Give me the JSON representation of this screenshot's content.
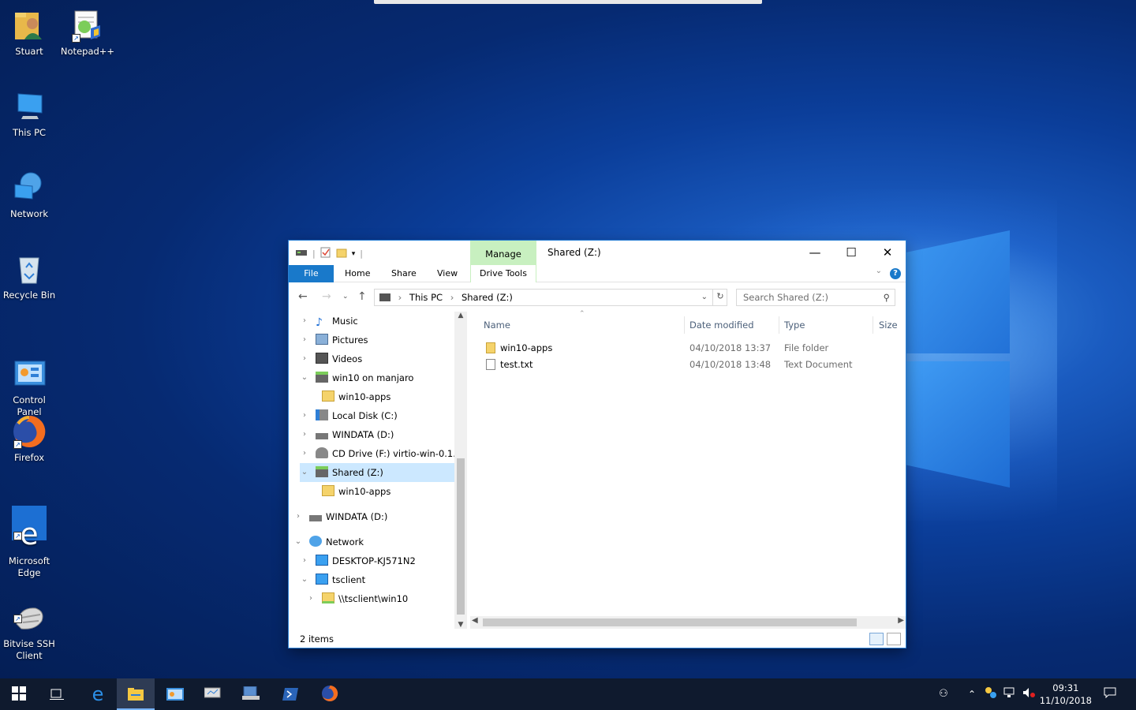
{
  "desktop": {
    "icons": [
      {
        "label": "Stuart",
        "icon": "user-folder-icon"
      },
      {
        "label": "Notepad++",
        "icon": "notepadpp-icon"
      },
      {
        "label": "This PC",
        "icon": "this-pc-icon"
      },
      {
        "label": "Network",
        "icon": "network-icon"
      },
      {
        "label": "Recycle Bin",
        "icon": "recycle-bin-icon"
      },
      {
        "label": "Control\nPanel",
        "icon": "control-panel-icon"
      },
      {
        "label": "Firefox",
        "icon": "firefox-icon"
      },
      {
        "label": "Microsoft\nEdge",
        "icon": "edge-icon"
      },
      {
        "label": "Bitvise SSH\nClient",
        "icon": "bitvise-icon"
      }
    ]
  },
  "explorer": {
    "title": "Shared (Z:)",
    "contextual_tab": "Manage",
    "contextual_group": "Drive Tools",
    "tabs": [
      "File",
      "Home",
      "Share",
      "View"
    ],
    "address": {
      "parts": [
        "This PC",
        "Shared (Z:)"
      ]
    },
    "search_placeholder": "Search Shared (Z:)",
    "nav": [
      {
        "label": "Music",
        "icon": "music-icon",
        "expanded": false
      },
      {
        "label": "Pictures",
        "icon": "pictures-icon",
        "expanded": false
      },
      {
        "label": "Videos",
        "icon": "videos-icon",
        "expanded": false
      },
      {
        "label": "win10 on manjaro",
        "icon": "network-drive-icon",
        "expanded": true
      },
      {
        "label": "win10-apps",
        "icon": "folder-icon",
        "expanded": null
      },
      {
        "label": "Local Disk (C:)",
        "icon": "local-disk-icon",
        "expanded": false
      },
      {
        "label": "WINDATA (D:)",
        "icon": "drive-icon",
        "expanded": false
      },
      {
        "label": "CD Drive (F:) virtio-win-0.1.1",
        "icon": "cd-drive-icon",
        "expanded": false
      },
      {
        "label": "Shared (Z:)",
        "icon": "network-drive-icon",
        "expanded": true,
        "selected": true
      },
      {
        "label": "win10-apps",
        "icon": "folder-icon",
        "expanded": null
      },
      {
        "label": "WINDATA (D:)",
        "icon": "drive-icon",
        "expanded": false
      },
      {
        "label": "Network",
        "icon": "network-icon",
        "expanded": true
      },
      {
        "label": "DESKTOP-KJ571N2",
        "icon": "computer-icon",
        "expanded": false
      },
      {
        "label": "tsclient",
        "icon": "computer-icon",
        "expanded": true
      },
      {
        "label": "\\\\tsclient\\win10",
        "icon": "share-folder-icon",
        "expanded": false
      }
    ],
    "columns": [
      "Name",
      "Date modified",
      "Type",
      "Size"
    ],
    "files": [
      {
        "name": "win10-apps",
        "date": "04/10/2018 13:37",
        "type": "File folder",
        "size": "",
        "icon": "folder-icon"
      },
      {
        "name": "test.txt",
        "date": "04/10/2018 13:48",
        "type": "Text Document",
        "size": "",
        "icon": "text-file-icon"
      }
    ],
    "status": "2 items"
  },
  "taskbar": {
    "clock_time": "09:31",
    "clock_date": "11/10/2018"
  }
}
